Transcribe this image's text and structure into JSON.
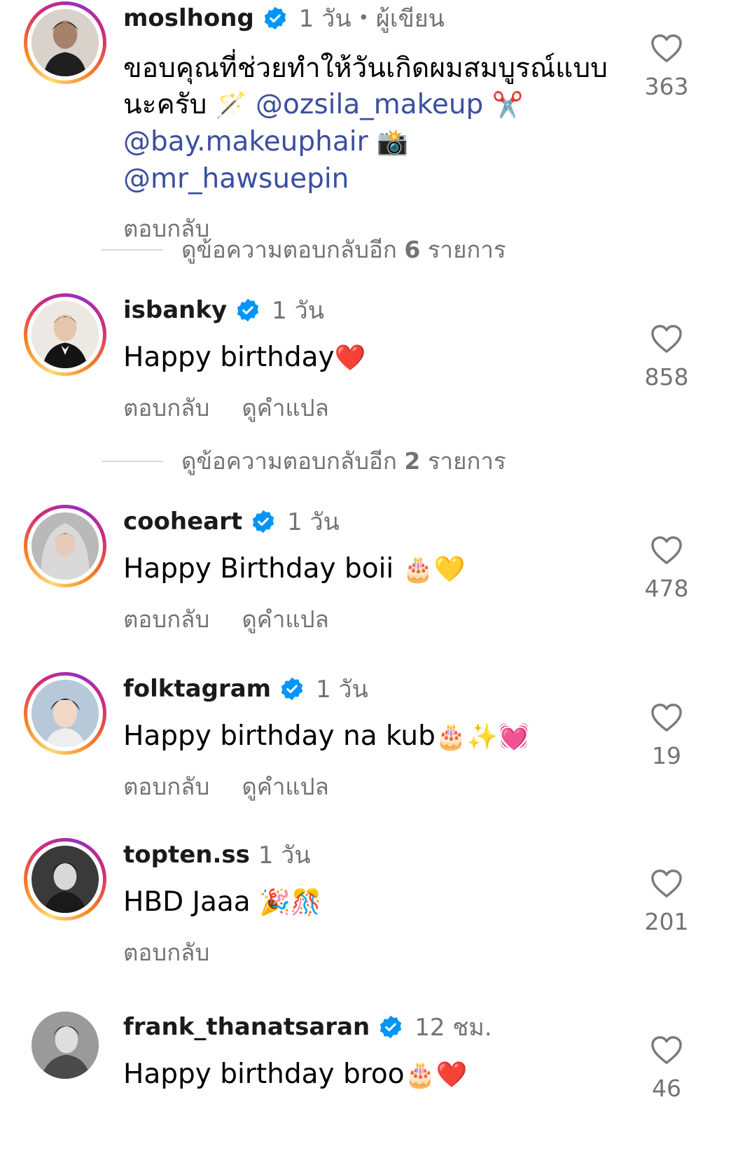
{
  "comments": [
    {
      "username": "moslhong",
      "verified": true,
      "time": "1 วัน",
      "author_label": "ผู้เขียน",
      "text_parts": [
        "ขอบคุณที่ช่วยทำให้วันเกิดผมสมบูรณ์แบบนะครับ ",
        "🪄",
        " ",
        "@ozsila_makeup",
        " ",
        "✂️",
        " ",
        "@bay.makeuphair",
        " ",
        "📸",
        " ",
        "@mr_hawsuepin"
      ],
      "reply_label": "ตอบกลับ",
      "likes": "363",
      "more_replies": {
        "prefix": "ดูข้อความตอบกลับอีก",
        "count": "6",
        "suffix": "รายการ"
      }
    },
    {
      "username": "isbanky",
      "verified": true,
      "time": "1 วัน",
      "text": "Happy birthday",
      "emoji": "❤️",
      "reply_label": "ตอบกลับ",
      "translate_label": "ดูคำแปล",
      "likes": "858",
      "more_replies": {
        "prefix": "ดูข้อความตอบกลับอีก",
        "count": "2",
        "suffix": "รายการ"
      }
    },
    {
      "username": "cooheart",
      "verified": true,
      "time": "1 วัน",
      "text": "Happy Birthday boii ",
      "emoji": "🎂💛",
      "reply_label": "ตอบกลับ",
      "translate_label": "ดูคำแปล",
      "likes": "478"
    },
    {
      "username": "folktagram",
      "verified": true,
      "time": "1 วัน",
      "text": "Happy birthday na kub",
      "emoji": "🎂✨💓",
      "reply_label": "ตอบกลับ",
      "translate_label": "ดูคำแปล",
      "likes": "19"
    },
    {
      "username": "topten.ss",
      "verified": false,
      "time": "1 วัน",
      "text": "HBD Jaaa ",
      "emoji": "🎉🎊",
      "reply_label": "ตอบกลับ",
      "likes": "201"
    },
    {
      "username": "frank_thanatsaran",
      "verified": true,
      "time": "12 ชม.",
      "text": "Happy birthday broo",
      "emoji": "🎂❤️",
      "likes": "46"
    }
  ],
  "colors": {
    "verified_badge": "#0095f6",
    "mention": "#3b4fa0",
    "secondary_text": "#737373"
  },
  "icons": {
    "like": "heart-outline-icon",
    "verified": "verified-badge-icon"
  }
}
